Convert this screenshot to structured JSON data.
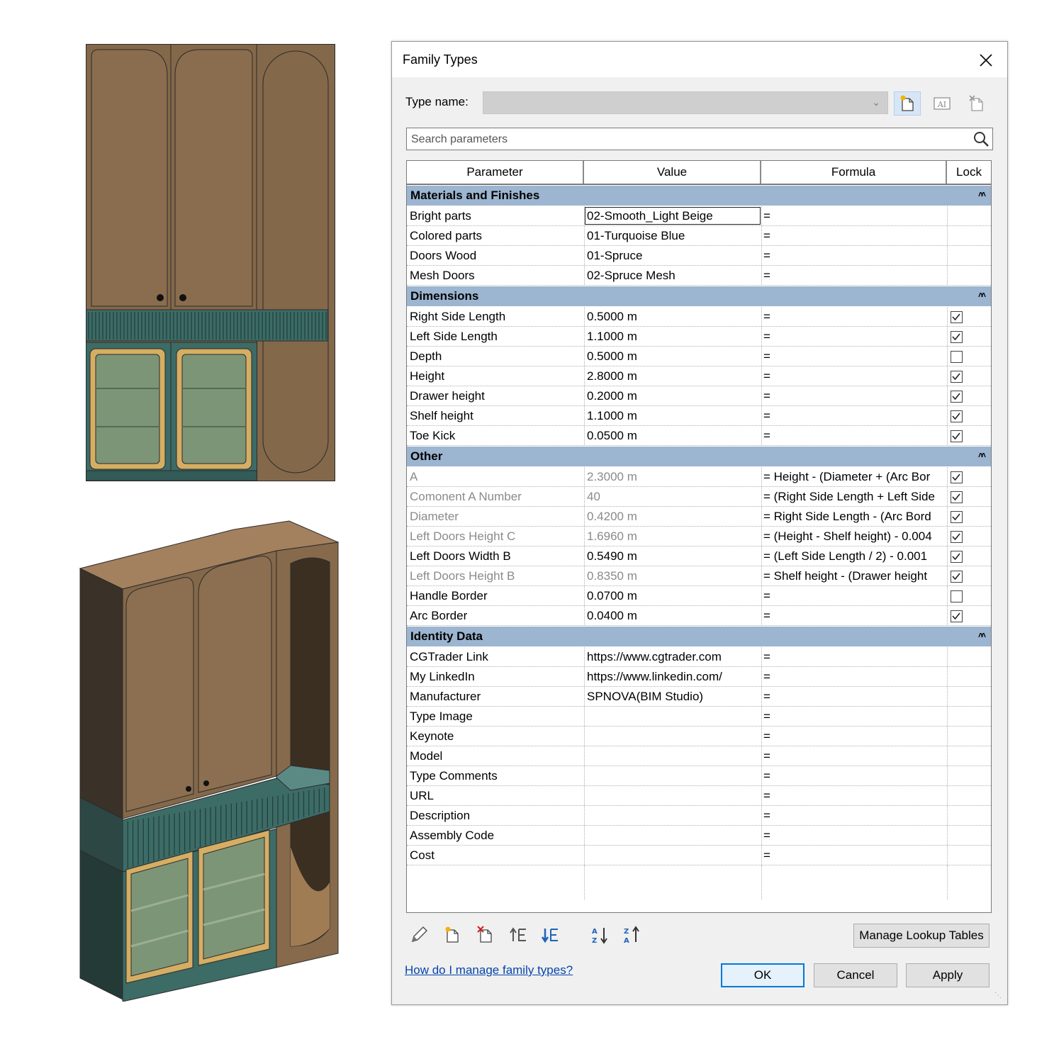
{
  "dialog": {
    "title": "Family Types",
    "close_label": "✕",
    "type_name_label": "Type name:",
    "type_name_value": "",
    "search_placeholder": "Search parameters",
    "columns": [
      "Parameter",
      "Value",
      "Formula",
      "Lock"
    ],
    "groups": [
      {
        "title": "Materials and Finishes",
        "rows": [
          {
            "param": "Bright parts",
            "value": "02-Smooth_Light Beige",
            "formula": "=",
            "lock": null,
            "editing": true
          },
          {
            "param": "Colored parts",
            "value": "01-Turquoise Blue",
            "formula": "=",
            "lock": null
          },
          {
            "param": "Doors Wood",
            "value": "01-Spruce",
            "formula": "=",
            "lock": null
          },
          {
            "param": "Mesh Doors",
            "value": "02-Spruce Mesh",
            "formula": "=",
            "lock": null
          }
        ]
      },
      {
        "title": "Dimensions",
        "rows": [
          {
            "param": "Right Side Length",
            "value": "0.5000 m",
            "formula": "=",
            "lock": true
          },
          {
            "param": "Left Side Length",
            "value": "1.1000 m",
            "formula": "=",
            "lock": true
          },
          {
            "param": "Depth",
            "value": "0.5000 m",
            "formula": "=",
            "lock": false
          },
          {
            "param": "Height",
            "value": "2.8000 m",
            "formula": "=",
            "lock": true
          },
          {
            "param": "Drawer height",
            "value": "0.2000 m",
            "formula": "=",
            "lock": true
          },
          {
            "param": "Shelf height",
            "value": "1.1000 m",
            "formula": "=",
            "lock": true
          },
          {
            "param": "Toe Kick",
            "value": "0.0500 m",
            "formula": "=",
            "lock": true
          }
        ]
      },
      {
        "title": "Other",
        "rows": [
          {
            "param": "A",
            "value": "2.3000 m",
            "formula": "= Height - (Diameter + (Arc Bor",
            "lock": true,
            "dim": true
          },
          {
            "param": "Comonent A Number",
            "value": "40",
            "formula": "= (Right Side Length + Left Side",
            "lock": true,
            "dim": true
          },
          {
            "param": "Diameter",
            "value": "0.4200 m",
            "formula": "= Right Side Length - (Arc Bord",
            "lock": true,
            "dim": true
          },
          {
            "param": "Left  Doors Height C",
            "value": "1.6960 m",
            "formula": "= (Height - Shelf height) - 0.004",
            "lock": true,
            "dim": true
          },
          {
            "param": "Left Doors Width B",
            "value": "0.5490 m",
            "formula": "= (Left Side Length / 2) - 0.001",
            "lock": true
          },
          {
            "param": "Left  Doors Height B",
            "value": "0.8350 m",
            "formula": "= Shelf height - (Drawer height",
            "lock": true,
            "dim": true
          },
          {
            "param": "Handle Border",
            "value": "0.0700 m",
            "formula": "=",
            "lock": false
          },
          {
            "param": "Arc Border",
            "value": "0.0400 m",
            "formula": "=",
            "lock": true
          }
        ]
      },
      {
        "title": "Identity Data",
        "rows": [
          {
            "param": "CGTrader Link",
            "value": "https://www.cgtrader.com",
            "formula": "=",
            "lock": null
          },
          {
            "param": "My LinkedIn",
            "value": "https://www.linkedin.com/",
            "formula": "=",
            "lock": null
          },
          {
            "param": "Manufacturer",
            "value": "SPNOVA(BIM Studio)",
            "formula": "=",
            "lock": null
          },
          {
            "param": "Type Image",
            "value": "",
            "formula": "=",
            "lock": null
          },
          {
            "param": "Keynote",
            "value": "",
            "formula": "=",
            "lock": null
          },
          {
            "param": "Model",
            "value": "",
            "formula": "=",
            "lock": null
          },
          {
            "param": "Type Comments",
            "value": "",
            "formula": "=",
            "lock": null
          },
          {
            "param": "URL",
            "value": "",
            "formula": "=",
            "lock": null
          },
          {
            "param": "Description",
            "value": "",
            "formula": "=",
            "lock": null
          },
          {
            "param": "Assembly Code",
            "value": "",
            "formula": "=",
            "lock": null
          },
          {
            "param": "Cost",
            "value": "",
            "formula": "=",
            "lock": null
          }
        ]
      }
    ],
    "manage_lookup_label": "Manage Lookup Tables",
    "help_link": "How do I manage family types?",
    "ok_label": "OK",
    "cancel_label": "Cancel",
    "apply_label": "Apply"
  },
  "colors": {
    "group_header": "#9cb5d0",
    "wood": "#84684a",
    "teal": "#3d6b66",
    "glass": "#7d9577",
    "brass": "#d6ae63",
    "link": "#0645ad",
    "ok_border": "#0078d7"
  },
  "icons": {
    "toolbar": [
      "edit-parameter-icon",
      "new-parameter-icon",
      "delete-parameter-icon",
      "move-up-icon",
      "move-down-icon",
      "sort-ascending-icon",
      "sort-descending-icon"
    ],
    "type": [
      "new-type-icon",
      "rename-type-icon",
      "delete-type-icon"
    ],
    "search": "search-icon"
  }
}
